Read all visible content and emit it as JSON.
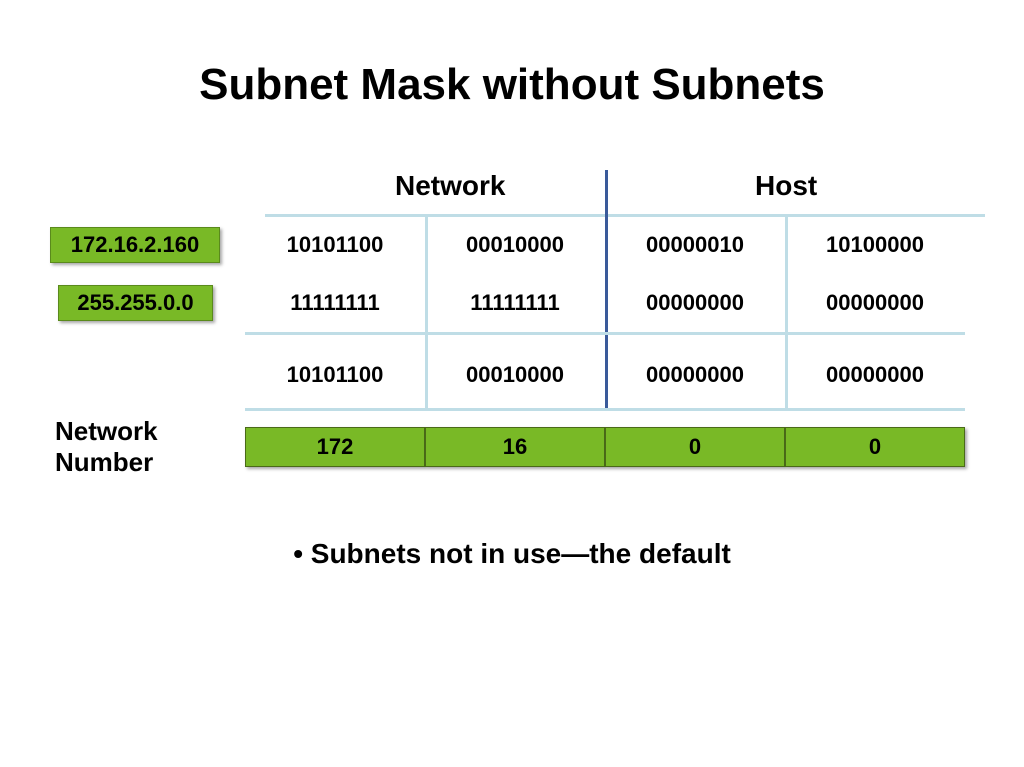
{
  "title": "Subnet Mask without Subnets",
  "headers": {
    "network": "Network",
    "host": "Host"
  },
  "labels": {
    "ip": "172.16.2.160",
    "mask": "255.255.0.0",
    "network_number": "Network\nNumber"
  },
  "rows": {
    "ip_bin": [
      "10101100",
      "00010000",
      "00000010",
      "10100000"
    ],
    "mask_bin": [
      "11111111",
      "11111111",
      "00000000",
      "00000000"
    ],
    "result_bin": [
      "10101100",
      "00010000",
      "00000000",
      "00000000"
    ],
    "result_dec": [
      "172",
      "16",
      "0",
      "0"
    ]
  },
  "bullet": "Subnets not in use—the default",
  "colors": {
    "green": "#79b926",
    "line": "#bfdde6",
    "centerline": "#3a5a9a"
  }
}
